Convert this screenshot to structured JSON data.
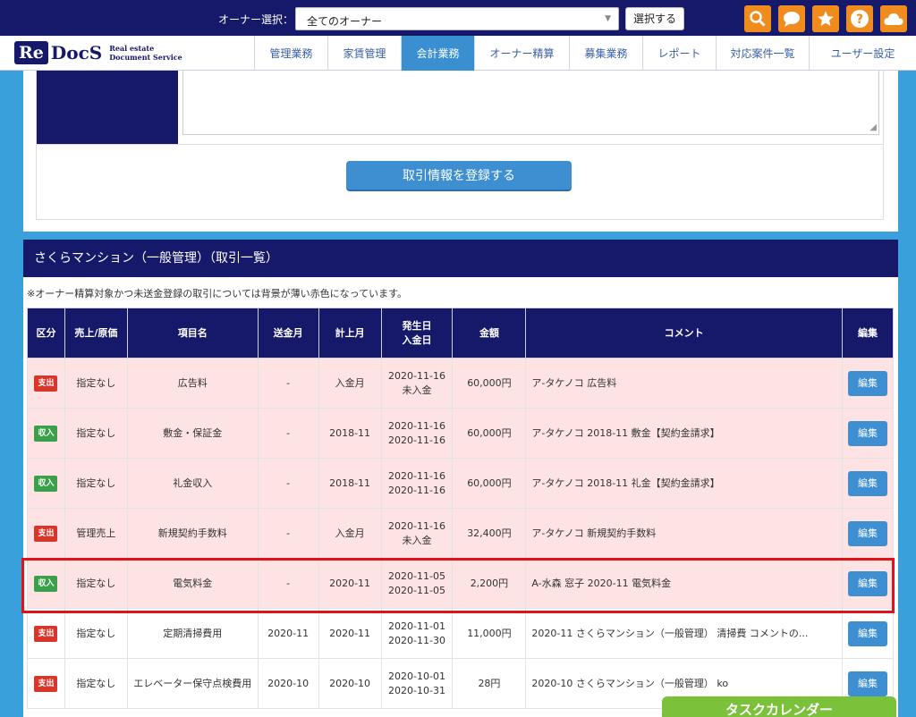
{
  "header": {
    "owner_label": "オーナー選択：",
    "owner_select_value": "全てのオーナー",
    "select_button": "選択する",
    "icons": [
      "search-icon",
      "chat-icon",
      "star-icon",
      "help-icon",
      "cloud-icon"
    ],
    "accent_color": "#f08c1e"
  },
  "logo": {
    "re": "Re",
    "docs": "DocS",
    "sub1": "Real estate",
    "sub2": "Document Service"
  },
  "nav": {
    "items": [
      {
        "label": "管理業務"
      },
      {
        "label": "家賃管理"
      },
      {
        "label": "会計業務"
      },
      {
        "label": "オーナー精算"
      },
      {
        "label": "募集業務"
      },
      {
        "label": "レポート"
      },
      {
        "label": "対応案件一覧"
      },
      {
        "label": "ユーザー設定"
      }
    ],
    "active": "会計業務"
  },
  "form": {
    "register_button": "取引情報を登録する"
  },
  "list": {
    "title": "さくらマンション（一般管理）（取引一覧）",
    "note": "※オーナー精算対象かつ未送金登録の取引については背景が薄い赤色になっています。",
    "columns": [
      "区分",
      "売上/原価",
      "項目名",
      "送金月",
      "計上月",
      "発生日",
      "入金日",
      "金額",
      "コメント",
      "編集"
    ],
    "rows": [
      {
        "type": "支出",
        "kind": "exp",
        "cost": "指定なし",
        "item": "広告料",
        "send": "-",
        "book": "入金月",
        "date1": "2020-11-16",
        "date2": "未入金",
        "amount": "60,000円",
        "comment": "ア-タケノコ 広告料",
        "edit": "編集",
        "pink": true
      },
      {
        "type": "収入",
        "kind": "inc",
        "cost": "指定なし",
        "item": "敷金・保証金",
        "send": "-",
        "book": "2018-11",
        "date1": "2020-11-16",
        "date2": "2020-11-16",
        "amount": "60,000円",
        "comment": "ア-タケノコ 2018-11 敷金【契約金請求】",
        "edit": "編集",
        "pink": true
      },
      {
        "type": "収入",
        "kind": "inc",
        "cost": "指定なし",
        "item": "礼金収入",
        "send": "-",
        "book": "2018-11",
        "date1": "2020-11-16",
        "date2": "2020-11-16",
        "amount": "60,000円",
        "comment": "ア-タケノコ 2018-11 礼金【契約金請求】",
        "edit": "編集",
        "pink": true
      },
      {
        "type": "支出",
        "kind": "exp",
        "cost": "管理売上",
        "item": "新規契約手数料",
        "send": "-",
        "book": "入金月",
        "date1": "2020-11-16",
        "date2": "未入金",
        "amount": "32,400円",
        "comment": "ア-タケノコ 新規契約手数料",
        "edit": "編集",
        "pink": true
      },
      {
        "type": "収入",
        "kind": "inc",
        "cost": "指定なし",
        "item": "電気料金",
        "send": "-",
        "book": "2020-11",
        "date1": "2020-11-05",
        "date2": "2020-11-05",
        "amount": "2,200円",
        "comment": "A-水森 窓子 2020-11 電気料金",
        "edit": "編集",
        "pink": true
      },
      {
        "type": "支出",
        "kind": "exp",
        "cost": "指定なし",
        "item": "定期清掃費用",
        "send": "2020-11",
        "book": "2020-11",
        "date1": "2020-11-01",
        "date2": "2020-11-30",
        "amount": "11,000円",
        "comment": "2020-11 さくらマンション（一般管理） 清掃費 コメントの...",
        "edit": "編集",
        "pink": false
      },
      {
        "type": "支出",
        "kind": "exp",
        "cost": "指定なし",
        "item": "エレベーター保守点検費用",
        "send": "2020-10",
        "book": "2020-10",
        "date1": "2020-10-01",
        "date2": "2020-10-31",
        "amount": "28円",
        "comment": "2020-10 さくらマンション（一般管理） ko",
        "edit": "編集",
        "pink": false
      }
    ]
  },
  "task_calendar": "タスクカレンダー"
}
